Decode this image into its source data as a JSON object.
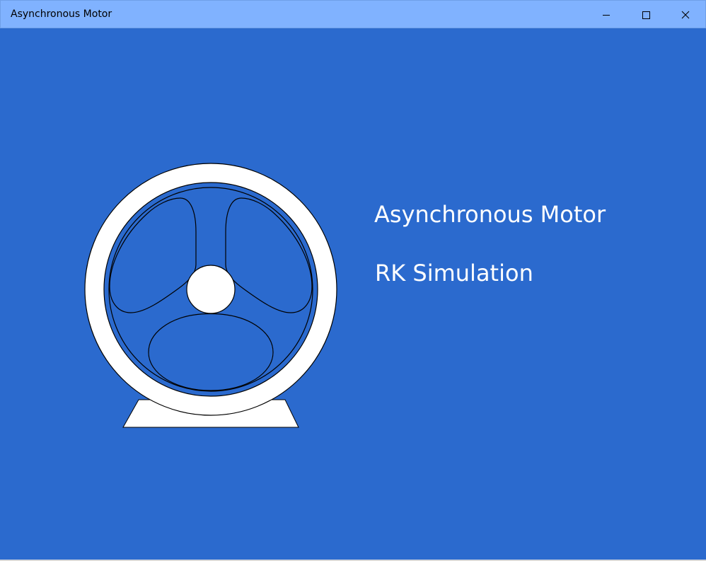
{
  "window": {
    "title": "Asynchronous Motor",
    "titlebar_color": "#80b2ff",
    "background_color": "#2b6ace",
    "controls": {
      "minimize": "minimize-icon",
      "maximize": "maximize-icon",
      "close": "close-icon"
    }
  },
  "content": {
    "title": "Asynchronous Motor",
    "subtitle": "RK Simulation"
  },
  "illustration": {
    "icon": "motor-icon",
    "fill_color": "#ffffff",
    "stroke_color": "#000000"
  }
}
